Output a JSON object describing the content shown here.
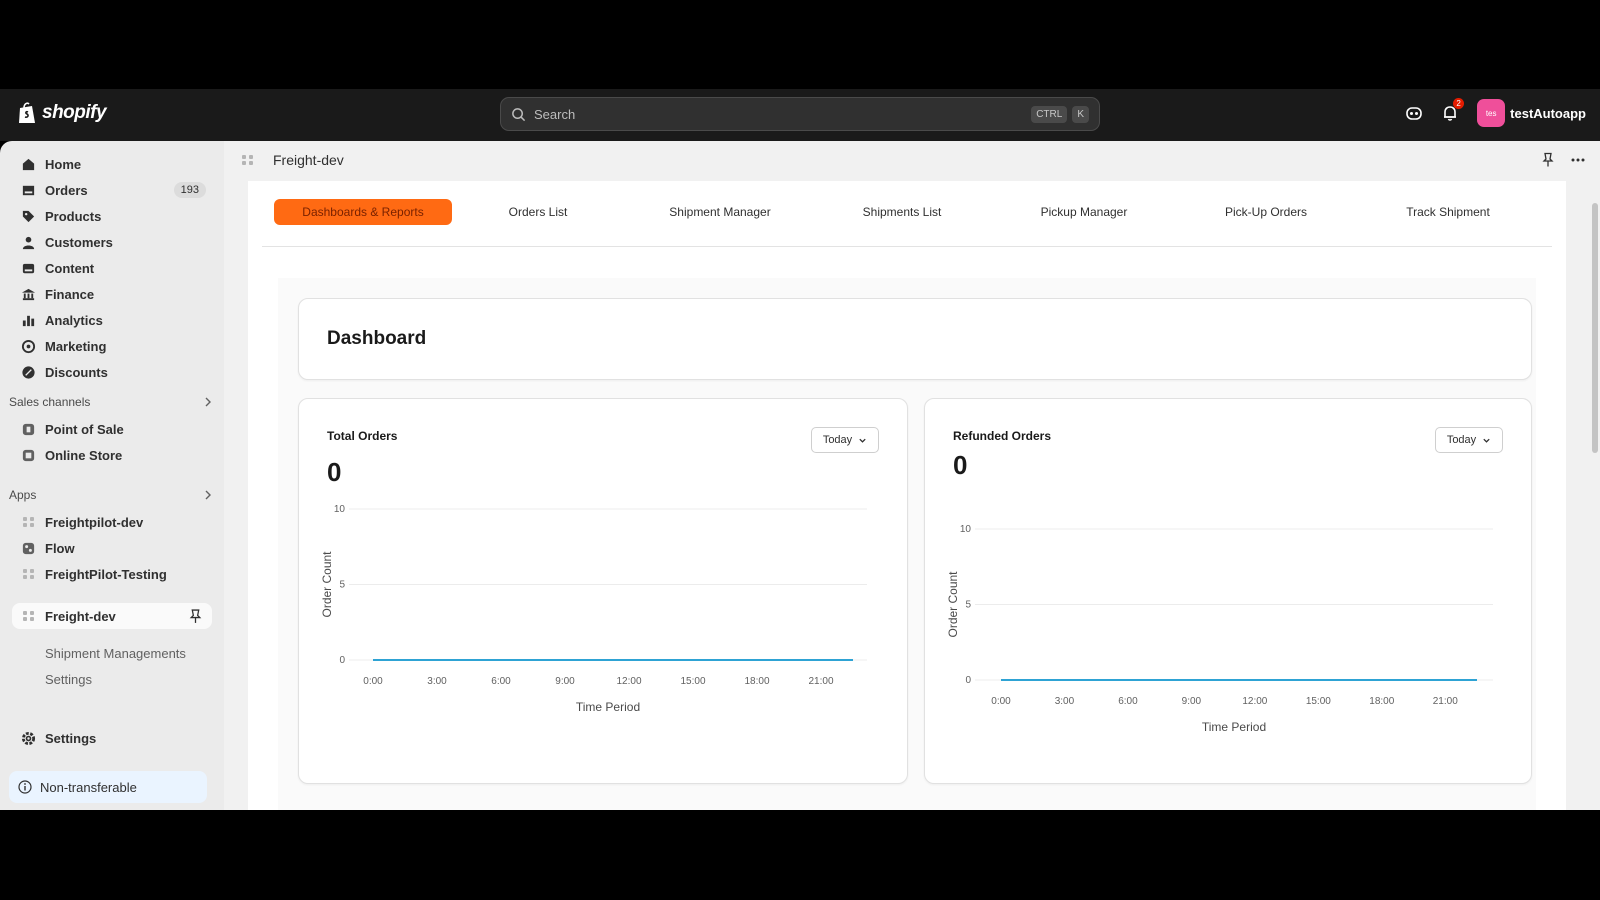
{
  "topbar": {
    "logo_text": "shopify",
    "search_placeholder": "Search",
    "shortcut_key1": "CTRL",
    "shortcut_key2": "K",
    "notification_count": "2",
    "avatar_initials": "tes",
    "account_name": "testAutoapp"
  },
  "sidebar": {
    "items": [
      {
        "label": "Home",
        "icon": "home-icon"
      },
      {
        "label": "Orders",
        "icon": "orders-icon",
        "badge": "193"
      },
      {
        "label": "Products",
        "icon": "tag-icon"
      },
      {
        "label": "Customers",
        "icon": "person-icon"
      },
      {
        "label": "Content",
        "icon": "content-icon"
      },
      {
        "label": "Finance",
        "icon": "bank-icon"
      },
      {
        "label": "Analytics",
        "icon": "bar-chart-icon"
      },
      {
        "label": "Marketing",
        "icon": "target-icon"
      },
      {
        "label": "Discounts",
        "icon": "discount-icon"
      }
    ],
    "sales_channels_label": "Sales channels",
    "sales_channels": [
      {
        "label": "Point of Sale",
        "icon": "pos-icon"
      },
      {
        "label": "Online Store",
        "icon": "store-icon"
      }
    ],
    "apps_label": "Apps",
    "apps": [
      {
        "label": "Freightpilot-dev",
        "icon": "app-dots-icon"
      },
      {
        "label": "Flow",
        "icon": "flow-icon"
      },
      {
        "label": "FreightPilot-Testing",
        "icon": "app-dots-icon"
      }
    ],
    "active_app": "Freight-dev",
    "active_app_subitems": [
      "Shipment Managements",
      "Settings"
    ],
    "settings_label": "Settings",
    "nontransferable_label": "Non-transferable"
  },
  "page": {
    "title": "Freight-dev",
    "tabs": [
      "Dashboards & Reports",
      "Orders List",
      "Shipment Manager",
      "Shipments List",
      "Pickup Manager",
      "Pick-Up Orders",
      "Track Shipment"
    ],
    "dashboard_title": "Dashboard",
    "cards": [
      {
        "title": "Total Orders",
        "value": "0",
        "filter": "Today"
      },
      {
        "title": "Refunded Orders",
        "value": "0",
        "filter": "Today"
      }
    ]
  },
  "colors": {
    "accent": "#ff6a13",
    "line": "#2ea3d4"
  },
  "chart_data": [
    {
      "type": "line",
      "title": "Total Orders",
      "xlabel": "Time Period",
      "ylabel": "Order Count",
      "x": [
        "0:00",
        "3:00",
        "6:00",
        "9:00",
        "12:00",
        "15:00",
        "18:00",
        "21:00"
      ],
      "y_ticks": [
        0,
        5,
        10
      ],
      "ylim": [
        0,
        10
      ],
      "series": [
        {
          "values": [
            0,
            0,
            0,
            0,
            0,
            0,
            0,
            0
          ]
        }
      ]
    },
    {
      "type": "line",
      "title": "Refunded Orders",
      "xlabel": "Time Period",
      "ylabel": "Order Count",
      "x": [
        "0:00",
        "3:00",
        "6:00",
        "9:00",
        "12:00",
        "15:00",
        "18:00",
        "21:00"
      ],
      "y_ticks": [
        0,
        5,
        10
      ],
      "ylim": [
        0,
        10
      ],
      "series": [
        {
          "values": [
            0,
            0,
            0,
            0,
            0,
            0,
            0,
            0
          ]
        }
      ]
    }
  ]
}
